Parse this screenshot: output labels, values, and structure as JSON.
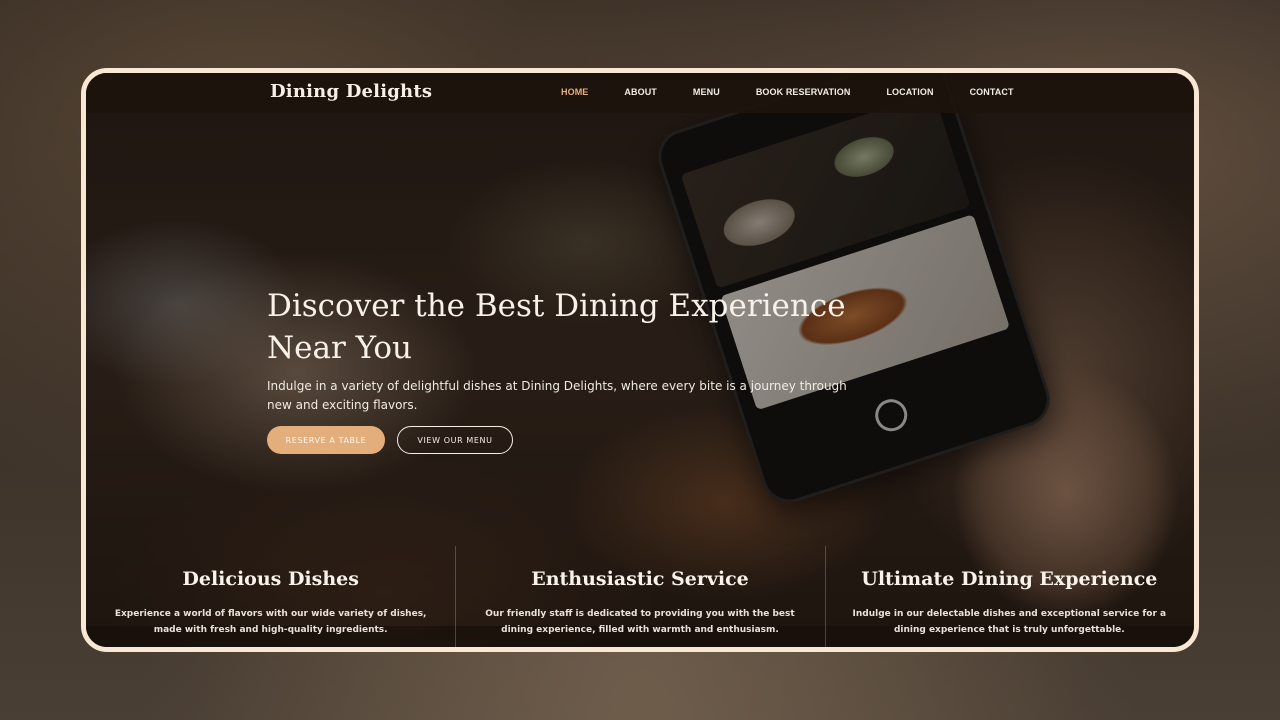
{
  "site": {
    "logo": "Dining Delights"
  },
  "nav": {
    "items": [
      {
        "label": "HOME",
        "active": true
      },
      {
        "label": "ABOUT",
        "active": false
      },
      {
        "label": "MENU",
        "active": false
      },
      {
        "label": "BOOK RESERVATION",
        "active": false
      },
      {
        "label": "LOCATION",
        "active": false
      },
      {
        "label": "CONTACT",
        "active": false
      }
    ]
  },
  "hero": {
    "title": "Discover the Best Dining Experience Near You",
    "text": "Indulge in a variety of delightful dishes at Dining Delights, where every bite is a journey through new and exciting flavors.",
    "primary_button": "RESERVE A TABLE",
    "secondary_button": "VIEW OUR MENU"
  },
  "features": [
    {
      "title": "Delicious Dishes",
      "text": "Experience a world of flavors with our wide variety of dishes, made with fresh and high-quality ingredients."
    },
    {
      "title": "Enthusiastic Service",
      "text": "Our friendly staff is dedicated to providing you with the best dining experience, filled with warmth and enthusiasm."
    },
    {
      "title": "Ultimate Dining Experience",
      "text": "Indulge in our delectable dishes and exceptional service for a dining experience that is truly unforgettable."
    }
  ],
  "colors": {
    "accent": "#e4ad7c",
    "frame_border": "#f8e7d2",
    "nav_background": "#1c130c"
  },
  "icons": [
    "camera-shutter-icon"
  ]
}
